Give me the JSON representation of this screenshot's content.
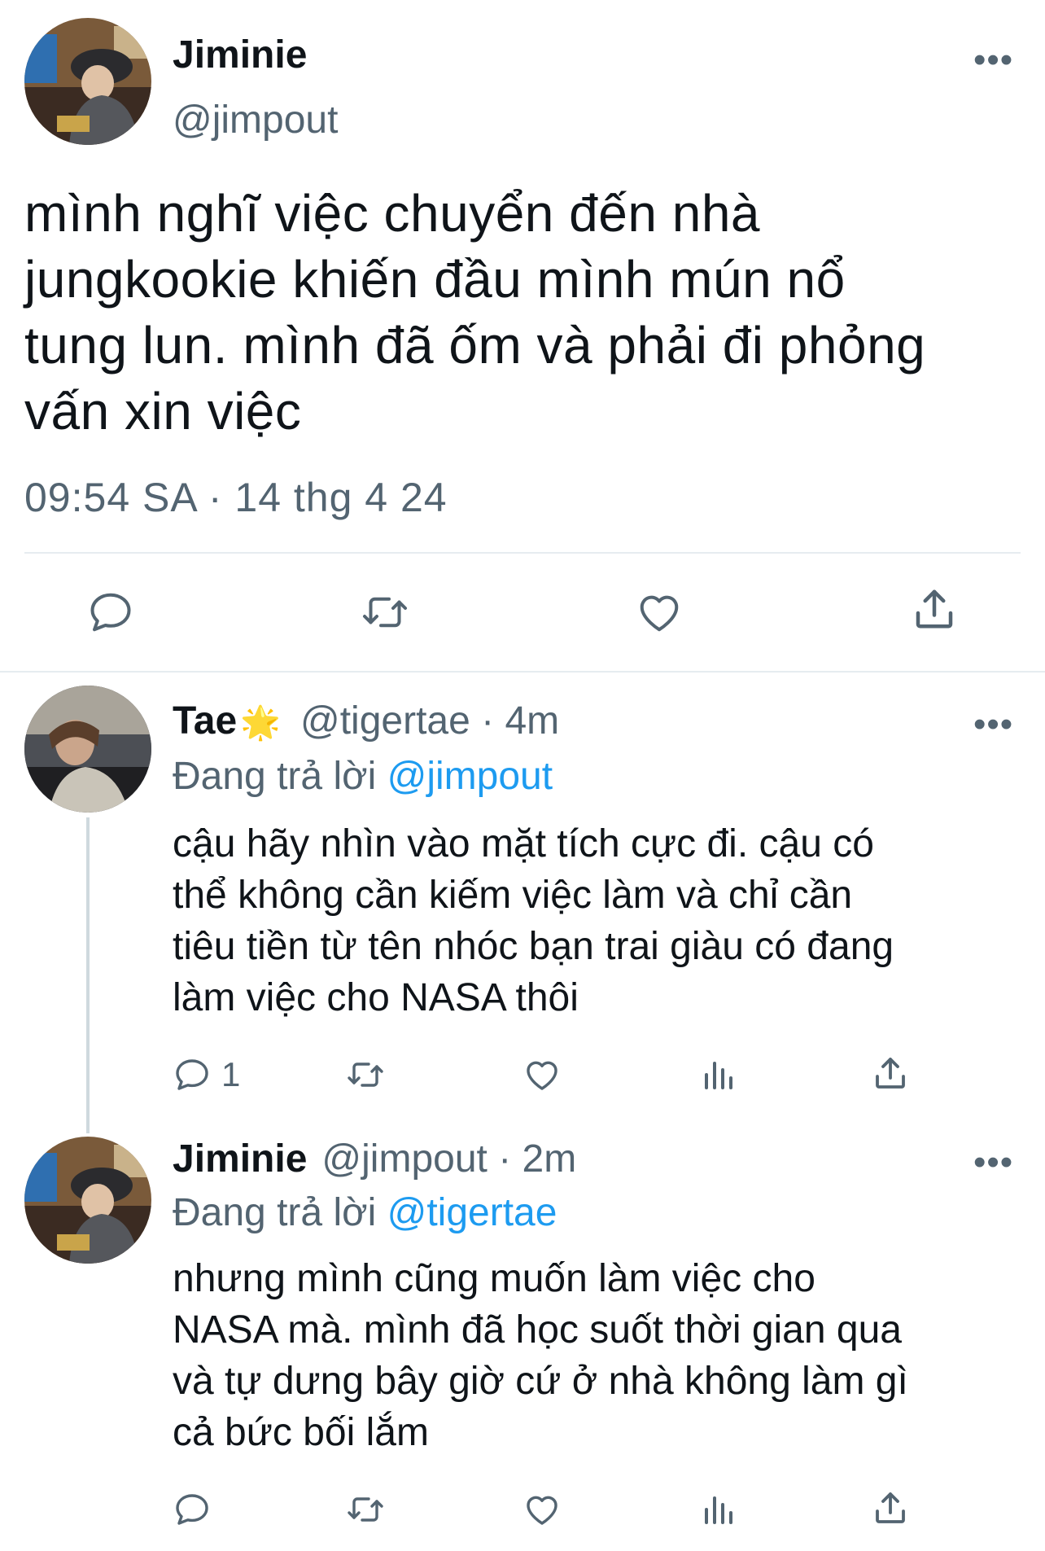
{
  "main_tweet": {
    "display_name": "Jiminie",
    "handle": "@jimpout",
    "text": "mình nghĩ việc chuyển đến nhà\njungkookie khiến đầu mình mún nổ\ntung lun. mình đã ốm và phải đi phỏng\nvấn xin việc",
    "timestamp": "09:54 SA · 14 thg 4 24",
    "more_label": "•••",
    "actions": [
      "reply-icon",
      "retweet-icon",
      "like-icon",
      "share-icon"
    ]
  },
  "replies": [
    {
      "display_name": "Tae",
      "badge_emoji": "🌟",
      "handle_time": "@tigertae · 4m",
      "replying_prefix": "Đang trả lời",
      "replying_to": "@jimpout",
      "text": "cậu hãy nhìn vào mặt tích cực đi. cậu có\nthể không cần kiếm việc làm và chỉ cần\ntiêu tiền từ tên nhóc bạn trai giàu có đang\nlàm việc cho NASA thôi",
      "reply_count": "1",
      "more_label": "•••"
    },
    {
      "display_name": "Jiminie",
      "handle_time": "@jimpout · 2m",
      "replying_prefix": "Đang trả lời",
      "replying_to": "@tigertae",
      "text": "nhưng mình cũng muốn làm việc cho\nNASA mà. mình đã học suốt thời gian qua\nvà tự dưng bây giờ cứ ở nhà không làm gì\ncả bức bối lắm",
      "more_label": "•••"
    }
  ],
  "colors": {
    "text": "#0f1419",
    "muted": "#536471",
    "link": "#1d9bf0",
    "divider": "#e6ecf0"
  }
}
